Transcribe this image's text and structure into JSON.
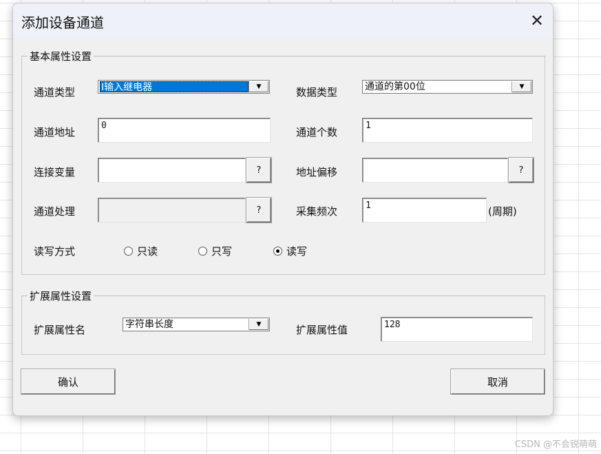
{
  "dialog": {
    "title": "添加设备通道",
    "close_glyph": "✕"
  },
  "basic": {
    "group_title": "基本属性设置",
    "channel_type_label": "通道类型",
    "channel_type_value": "I输入继电器",
    "data_type_label": "数据类型",
    "data_type_value": "通道的第00位",
    "channel_address_label": "通道地址",
    "channel_address_value": "0",
    "channel_count_label": "通道个数",
    "channel_count_value": "1",
    "connect_var_label": "连接变量",
    "connect_var_value": "",
    "address_offset_label": "地址偏移",
    "address_offset_value": "",
    "channel_process_label": "通道处理",
    "channel_process_value": "",
    "sample_freq_label": "采集频次",
    "sample_freq_value": "1",
    "sample_freq_unit": "(周期)",
    "browse_label": "?",
    "rw_mode_label": "读写方式",
    "rw_options": [
      {
        "label": "只读",
        "checked": false
      },
      {
        "label": "只写",
        "checked": false
      },
      {
        "label": "读写",
        "checked": true
      }
    ]
  },
  "extended": {
    "group_title": "扩展属性设置",
    "attr_name_label": "扩展属性名",
    "attr_name_value": "字符串长度",
    "attr_value_label": "扩展属性值",
    "attr_value_value": "128"
  },
  "buttons": {
    "confirm": "确认",
    "cancel": "取消"
  },
  "watermark": "CSDN @不会锐萌萌"
}
